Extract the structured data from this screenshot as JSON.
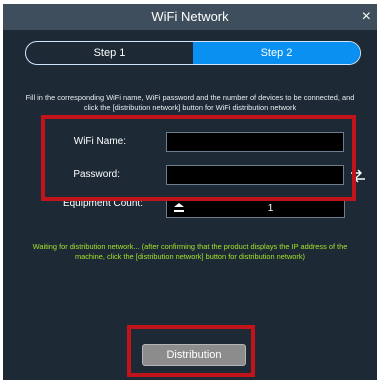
{
  "window": {
    "title": "WiFi Network",
    "close_glyph": "×"
  },
  "steps": [
    {
      "label": "Step 1"
    },
    {
      "label": "Step 2"
    }
  ],
  "instructions": "Fill in the corresponding WiFi name, WiFi password and the number of devices to be connected, and click the [distribution network] button for WiFi distribution network",
  "form": {
    "wifi_name_label": "WiFi Name:",
    "wifi_name_value": "",
    "password_label": "Password:",
    "password_value": "",
    "equipment_count_label": "Equipment Count:",
    "equipment_count_value": "1"
  },
  "status": "Waiting for distribution network... (after confirming that the product displays the IP address of the machine, click the [distribution network] button for distribution network)",
  "distribution_button": "Distribution",
  "colors": {
    "dialog_bg": "#1d2a35",
    "titlebar_bg": "#3e4e5c",
    "accent": "#0a90f0",
    "status_text": "#a6e22e",
    "highlight": "#c0141a"
  },
  "icons": {
    "password_toggle": "swap-arrows-icon",
    "stepper": "stepper-arrows-icon"
  }
}
